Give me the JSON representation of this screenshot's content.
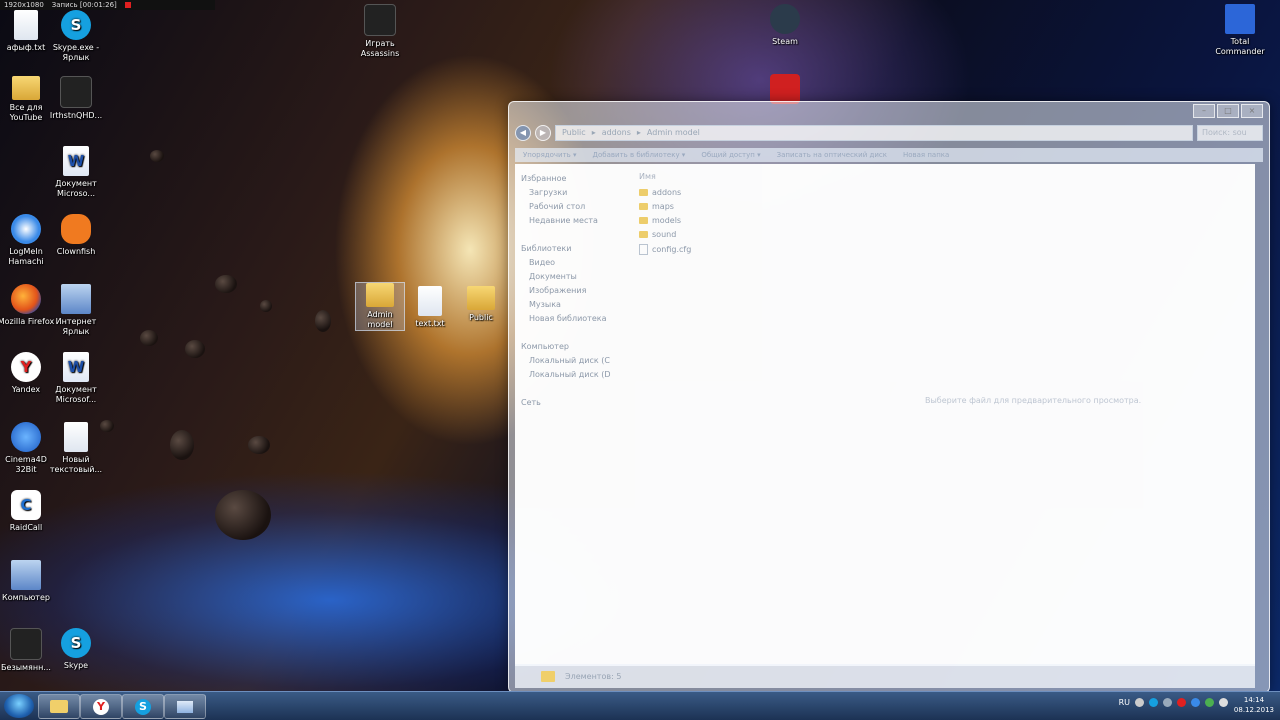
{
  "recorder": {
    "resolution": "1920x1080",
    "status": "Запись [00:01:26]"
  },
  "desktop_icons": [
    {
      "label": "афыф.txt"
    },
    {
      "label": "Skype.exe - Ярлык"
    },
    {
      "label": "Все для YouTube"
    },
    {
      "label": "IrthstnQHD..."
    },
    {
      "label": "Документ Microso..."
    },
    {
      "label": "LogMeIn Hamachi"
    },
    {
      "label": "Clownfish"
    },
    {
      "label": "Mozilla Firefox"
    },
    {
      "label": "Интернет Ярлык"
    },
    {
      "label": "Yandex"
    },
    {
      "label": "Документ Microsof..."
    },
    {
      "label": "Cinema4D 32Bit"
    },
    {
      "label": "Новый текстовый..."
    },
    {
      "label": "RaidCall"
    },
    {
      "label": "Компьютер"
    },
    {
      "label": "Безымянн..."
    },
    {
      "label": "Skype"
    },
    {
      "label": "Играть Assassins"
    },
    {
      "label": "Steam"
    },
    {
      "label": "Total Commander"
    },
    {
      "label": "Admin model"
    },
    {
      "label": "text.txt"
    },
    {
      "label": "Public"
    }
  ],
  "explorer": {
    "address": [
      "Public",
      "addons",
      "Admin model"
    ],
    "search_placeholder": "Поиск: sou",
    "toolbar": [
      "Упорядочить ▾",
      "Добавить в библиотеку ▾",
      "Общий доступ ▾",
      "Записать на оптический диск",
      "Новая папка"
    ],
    "nav_pane": {
      "favorites_header": "Избранное",
      "favorites": [
        "Загрузки",
        "Рабочий стол",
        "Недавние места"
      ],
      "libraries_header": "Библиотеки",
      "libraries": [
        "Видео",
        "Документы",
        "Изображения",
        "Музыка",
        "Новая библиотека"
      ],
      "computer_header": "Компьютер",
      "drives": [
        "Локальный диск (C",
        "Локальный диск (D"
      ],
      "network": "Сеть"
    },
    "column_header": "Имя",
    "files": [
      {
        "name": "addons",
        "type": "folder"
      },
      {
        "name": "maps",
        "type": "folder"
      },
      {
        "name": "models",
        "type": "folder"
      },
      {
        "name": "sound",
        "type": "folder"
      },
      {
        "name": "config.cfg",
        "type": "file"
      }
    ],
    "preview_text": "Выберите файл для предварительного просмотра.",
    "status": "Элементов: 5"
  },
  "taskbar": {
    "lang": "RU",
    "time": "14:14",
    "date": "08.12.2013"
  }
}
